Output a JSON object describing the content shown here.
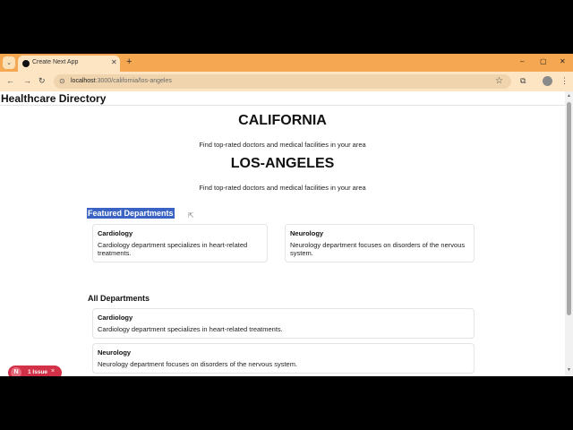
{
  "browser": {
    "tab_title": "Create Next App",
    "new_tab_glyph": "+",
    "url_host": "localhost",
    "url_path": ":3000/california/los-angeles",
    "window_controls": [
      "–",
      "▢",
      "✕"
    ]
  },
  "site": {
    "title": "Healthcare Directory"
  },
  "hero": {
    "state": "CALIFORNIA",
    "state_subtitle": "Find top-rated doctors and medical facilities in your area",
    "city": "LOS-ANGELES",
    "city_subtitle": "Find top-rated doctors and medical facilities in your area"
  },
  "featured": {
    "title": "Featured Departments",
    "cards": [
      {
        "name": "Cardiology",
        "desc": "Cardiology department specializes in heart-related treatments."
      },
      {
        "name": "Neurology",
        "desc": "Neurology department focuses on disorders of the nervous system."
      }
    ]
  },
  "all_departments": {
    "title": "All Departments",
    "items": [
      {
        "name": "Cardiology",
        "desc": "Cardiology department specializes in heart-related treatments."
      },
      {
        "name": "Neurology",
        "desc": "Neurology department focuses on disorders of the nervous system."
      }
    ]
  },
  "dev_overlay": {
    "badge_letter": "N",
    "issues_label": "1 Issue",
    "close_glyph": "×"
  },
  "colors": {
    "tab_strip": "#f5a751",
    "toolbar": "#fde5c4",
    "selection": "#3b63c4",
    "issue_badge": "#d33148"
  }
}
